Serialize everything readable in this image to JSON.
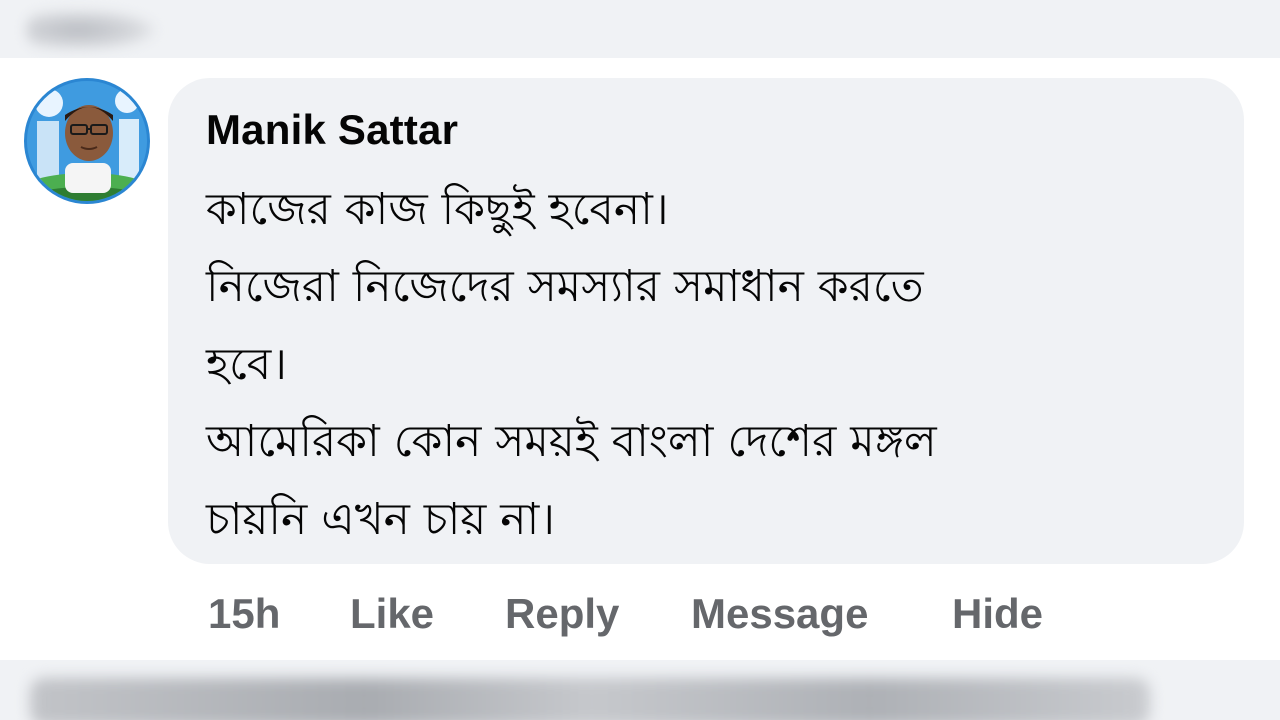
{
  "comment": {
    "author": "Manik Sattar",
    "lines": [
      "কাজের কাজ কিছুই হবেনা।",
      "নিজেরা নিজেদের সমস্যার সমাধান করতে",
      "হবে।",
      "আমেরিকা কোন সময়ই বাংলা দেশের মঙ্গল",
      "চায়নি এখন চায় না।"
    ],
    "timestamp": "15h",
    "actions": {
      "like": "Like",
      "reply": "Reply",
      "message": "Message",
      "hide": "Hide"
    }
  },
  "colors": {
    "bubble": "#f0f2f5",
    "text": "#050505",
    "secondary_text": "#65676b",
    "avatar_ring": "#2b86d2"
  }
}
